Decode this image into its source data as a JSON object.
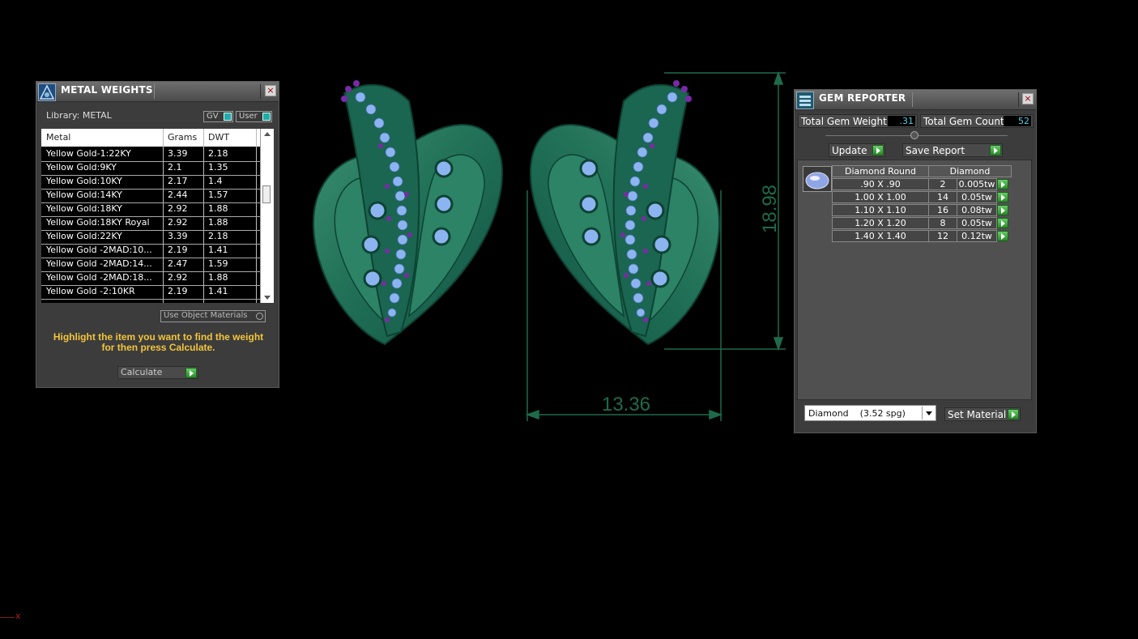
{
  "metal_panel": {
    "title": "METAL WEIGHTS",
    "library_label": "Library: METAL",
    "gv_label": "GV",
    "user_label": "User",
    "columns": [
      "Metal",
      "Grams",
      "DWT"
    ],
    "rows": [
      {
        "metal": "Yellow Gold-1:22KY",
        "grams": "3.39",
        "dwt": "2.18"
      },
      {
        "metal": "Yellow Gold:9KY",
        "grams": "2.1",
        "dwt": "1.35"
      },
      {
        "metal": "Yellow Gold:10KY",
        "grams": "2.17",
        "dwt": "1.4"
      },
      {
        "metal": "Yellow Gold:14KY",
        "grams": "2.44",
        "dwt": "1.57"
      },
      {
        "metal": "Yellow Gold:18KY",
        "grams": "2.92",
        "dwt": "1.88"
      },
      {
        "metal": "Yellow Gold:18KY Royal",
        "grams": "2.92",
        "dwt": "1.88"
      },
      {
        "metal": "Yellow Gold:22KY",
        "grams": "3.39",
        "dwt": "2.18"
      },
      {
        "metal": "Yellow Gold -2MAD:10...",
        "grams": "2.19",
        "dwt": "1.41"
      },
      {
        "metal": "Yellow Gold -2MAD:14...",
        "grams": "2.47",
        "dwt": "1.59"
      },
      {
        "metal": "Yellow Gold -2MAD:18...",
        "grams": "2.92",
        "dwt": "1.88"
      },
      {
        "metal": "Yellow Gold -2:10KR",
        "grams": "2.19",
        "dwt": "1.41"
      }
    ],
    "use_object_materials": "Use Object Materials",
    "instruction_line1": "Highlight the item you want to find the weight",
    "instruction_line2": "for then press Calculate.",
    "calculate_label": "Calculate"
  },
  "viewport": {
    "dim_height": "18.98",
    "dim_width": "13.36",
    "axis_marker": "x"
  },
  "gem_panel": {
    "title": "GEM REPORTER",
    "total_weight_label": "Total Gem Weight",
    "total_weight_value": ".31",
    "total_count_label": "Total Gem Count",
    "total_count_value": "52",
    "update_label": "Update",
    "save_report_label": "Save Report",
    "header_shape": "Diamond Round",
    "header_material": "Diamond",
    "rows": [
      {
        "size": ".90 X .90",
        "count": "2",
        "weight": "0.005tw"
      },
      {
        "size": "1.00 X 1.00",
        "count": "14",
        "weight": "0.05tw"
      },
      {
        "size": "1.10 X 1.10",
        "count": "16",
        "weight": "0.08tw"
      },
      {
        "size": "1.20 X 1.20",
        "count": "8",
        "weight": "0.05tw"
      },
      {
        "size": "1.40 X 1.40",
        "count": "12",
        "weight": "0.12tw"
      }
    ],
    "material_select": "Diamond    (3.52 spg)",
    "set_material_label": "Set Material"
  },
  "colors": {
    "metal_green": "#1f6e55",
    "dim_green": "#1e6b4a",
    "gem_blue": "#8cb4f0",
    "gem_purple": "#7a2aa8",
    "instruction_yellow": "#f2c53a",
    "value_cyan": "#4fd0e8"
  }
}
